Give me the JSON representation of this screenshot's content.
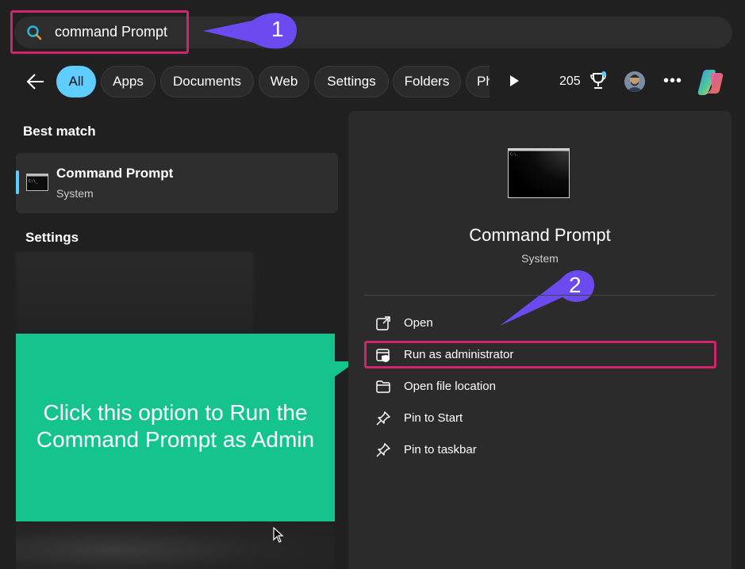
{
  "search": {
    "query": "command Prompt"
  },
  "filters": {
    "tabs": [
      {
        "label": "All",
        "active": true
      },
      {
        "label": "Apps"
      },
      {
        "label": "Documents"
      },
      {
        "label": "Web"
      },
      {
        "label": "Settings"
      },
      {
        "label": "Folders"
      },
      {
        "label": "Ph"
      }
    ],
    "points": "205"
  },
  "left": {
    "best_match_label": "Best match",
    "best_match": {
      "title": "Command Prompt",
      "subtitle": "System"
    },
    "settings_label": "Settings"
  },
  "preview": {
    "title": "Command Prompt",
    "subtitle": "System",
    "actions": [
      {
        "label": "Open",
        "icon": "open-external-icon"
      },
      {
        "label": "Run as administrator",
        "icon": "shield-window-icon"
      },
      {
        "label": "Open file location",
        "icon": "folder-icon"
      },
      {
        "label": "Pin to Start",
        "icon": "pin-icon"
      },
      {
        "label": "Pin to taskbar",
        "icon": "pin-icon"
      }
    ]
  },
  "annotations": {
    "step1": "1",
    "step2": "2",
    "callout_text": "Click this option to Run the Command Prompt as Admin",
    "highlight_color": "#d1246b",
    "callout_color": "#15c48c",
    "arrow_color": "#6b4bf0"
  },
  "colors": {
    "accent": "#60cdff",
    "background": "#202020",
    "panel": "#2b2b2b"
  }
}
